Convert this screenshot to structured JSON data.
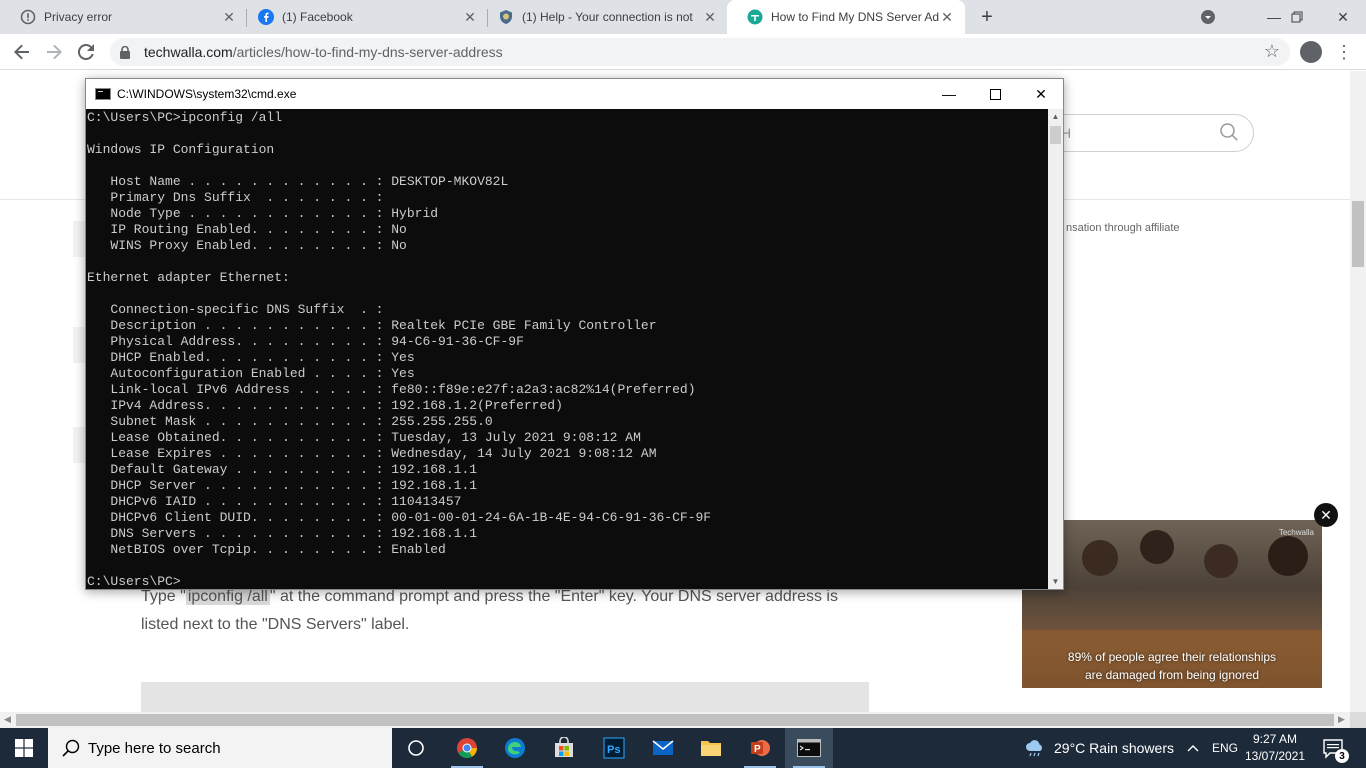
{
  "browser": {
    "tabs": [
      {
        "title": "Privacy error",
        "icon": "warning-circle-icon",
        "active": false
      },
      {
        "title": "(1) Facebook",
        "icon": "facebook-icon",
        "active": false
      },
      {
        "title": "(1) Help - Your connection is not",
        "icon": "help-shield-icon",
        "active": false
      },
      {
        "title": "How to Find My DNS Server Add",
        "icon": "techwalla-icon",
        "active": true
      }
    ],
    "url_domain": "techwalla.com",
    "url_path": "/articles/how-to-find-my-dns-server-address"
  },
  "page": {
    "search_glyph": "H",
    "affiliate_text": "nsation through affiliate",
    "article_line1_pre": "Type \"",
    "article_code": "ipconfig /all",
    "article_line1_post": "\" at the command prompt and press the \"Enter\" key. Your DNS server address is",
    "article_line2": "listed next to the \"DNS Servers\" label.",
    "ad_caption_1": "89% of people agree their relationships",
    "ad_caption_2": "are damaged from being ignored",
    "ad_brand": "Techwalla"
  },
  "cmd": {
    "title": "C:\\WINDOWS\\system32\\cmd.exe",
    "output": "C:\\Users\\PC>ipconfig /all\n\nWindows IP Configuration\n\n   Host Name . . . . . . . . . . . . : DESKTOP-MKOV82L\n   Primary Dns Suffix  . . . . . . . :\n   Node Type . . . . . . . . . . . . : Hybrid\n   IP Routing Enabled. . . . . . . . : No\n   WINS Proxy Enabled. . . . . . . . : No\n\nEthernet adapter Ethernet:\n\n   Connection-specific DNS Suffix  . :\n   Description . . . . . . . . . . . : Realtek PCIe GBE Family Controller\n   Physical Address. . . . . . . . . : 94-C6-91-36-CF-9F\n   DHCP Enabled. . . . . . . . . . . : Yes\n   Autoconfiguration Enabled . . . . : Yes\n   Link-local IPv6 Address . . . . . : fe80::f89e:e27f:a2a3:ac82%14(Preferred)\n   IPv4 Address. . . . . . . . . . . : 192.168.1.2(Preferred)\n   Subnet Mask . . . . . . . . . . . : 255.255.255.0\n   Lease Obtained. . . . . . . . . . : Tuesday, 13 July 2021 9:08:12 AM\n   Lease Expires . . . . . . . . . . : Wednesday, 14 July 2021 9:08:12 AM\n   Default Gateway . . . . . . . . . : 192.168.1.1\n   DHCP Server . . . . . . . . . . . : 192.168.1.1\n   DHCPv6 IAID . . . . . . . . . . . : 110413457\n   DHCPv6 Client DUID. . . . . . . . : 00-01-00-01-24-6A-1B-4E-94-C6-91-36-CF-9F\n   DNS Servers . . . . . . . . . . . : 192.168.1.1\n   NetBIOS over Tcpip. . . . . . . . : Enabled\n\nC:\\Users\\PC>"
  },
  "taskbar": {
    "search_placeholder": "Type here to search",
    "weather": "29°C  Rain showers",
    "language": "ENG",
    "time": "9:27 AM",
    "date": "13/07/2021",
    "notification_count": "3",
    "pinned": [
      "task-view-icon",
      "chrome-icon",
      "edge-icon",
      "store-icon",
      "photoshop-icon",
      "mail-icon",
      "file-explorer-icon",
      "powerpoint-icon",
      "cmd-icon"
    ]
  },
  "colors": {
    "taskbar_bg": "#1c2a3a",
    "console_bg": "#0c0c0c",
    "console_fg": "#cccccc",
    "tabstrip_bg": "#dee1e6"
  }
}
